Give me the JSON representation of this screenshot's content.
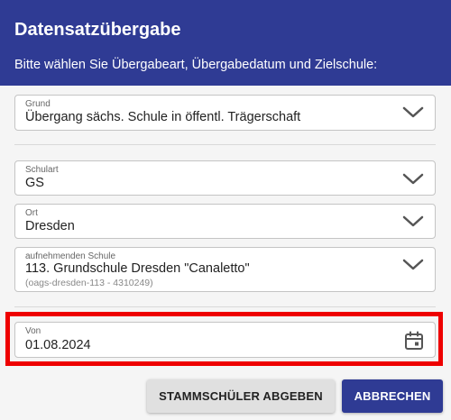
{
  "dialog": {
    "title": "Datensatzübergabe",
    "subtitle": "Bitte wählen Sie Übergabeart, Übergabedatum und Zielschule:"
  },
  "fields": {
    "grund": {
      "label": "Grund",
      "value": "Übergang sächs. Schule in öffentl. Trägerschaft",
      "icon": "chevron-down-icon"
    },
    "schulart": {
      "label": "Schulart",
      "value": "GS",
      "icon": "chevron-down-icon"
    },
    "ort": {
      "label": "Ort",
      "value": "Dresden",
      "icon": "chevron-down-icon"
    },
    "schule": {
      "label": "aufnehmenden Schule",
      "value": "113. Grundschule Dresden \"Canaletto\"",
      "detail": "(oags-dresden-113 - 4310249)",
      "icon": "chevron-down-icon"
    },
    "von": {
      "label": "Von",
      "value": "01.08.2024",
      "icon": "calendar-icon"
    }
  },
  "buttons": {
    "submit": "STAMMSCHÜLER ABGEBEN",
    "cancel": "ABBRECHEN"
  },
  "colors": {
    "header": "#2f3b94",
    "primary_button": "#2f3b94",
    "highlight": "#ee0000"
  }
}
